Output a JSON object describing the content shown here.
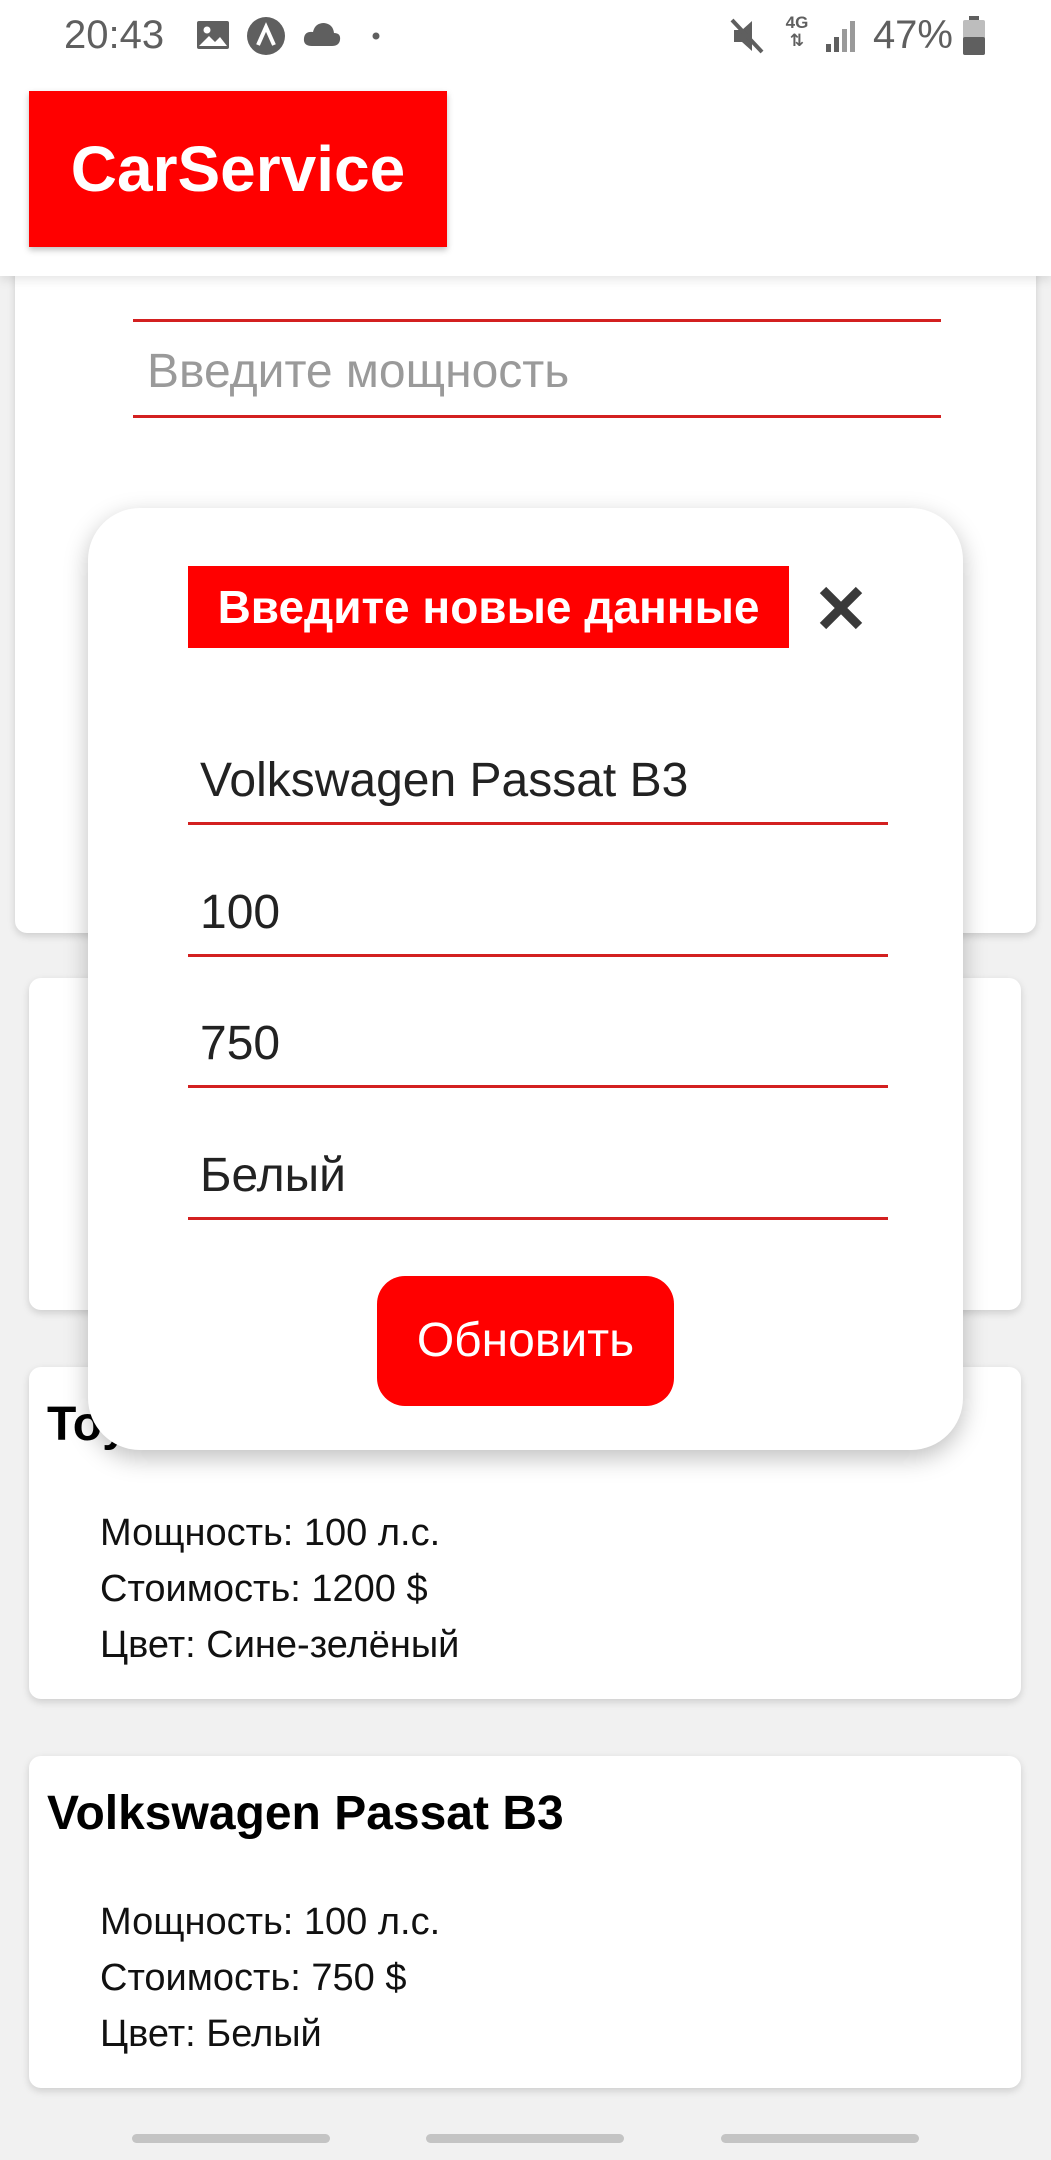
{
  "status_bar": {
    "time": "20:43",
    "battery_percent": "47%",
    "network": "4G",
    "icons": [
      "image-icon",
      "a-circle-icon",
      "cloud-icon",
      "dot-icon",
      "mute-icon",
      "network-4g-icon",
      "signal-icon",
      "battery-icon"
    ]
  },
  "app_bar": {
    "title": "CarService"
  },
  "form": {
    "power_placeholder": "Введите мощность"
  },
  "cars": [
    {
      "title": "Toyota",
      "power": "Мощность: 100 л.с.",
      "price": "Стоимость: 1200 $",
      "color": "Цвет: Сине-зелёный"
    },
    {
      "title": "Volkswagen Passat B3",
      "power": "Мощность: 100 л.с.",
      "price": "Стоимость: 750 $",
      "color": "Цвет: Белый"
    }
  ],
  "modal": {
    "title": "Введите новые данные",
    "fields": {
      "name": "Volkswagen Passat B3",
      "power": "100",
      "price": "750",
      "color": "Белый"
    },
    "submit_label": "Обновить"
  },
  "colors": {
    "accent": "#ff0000",
    "underline": "#d32020"
  }
}
